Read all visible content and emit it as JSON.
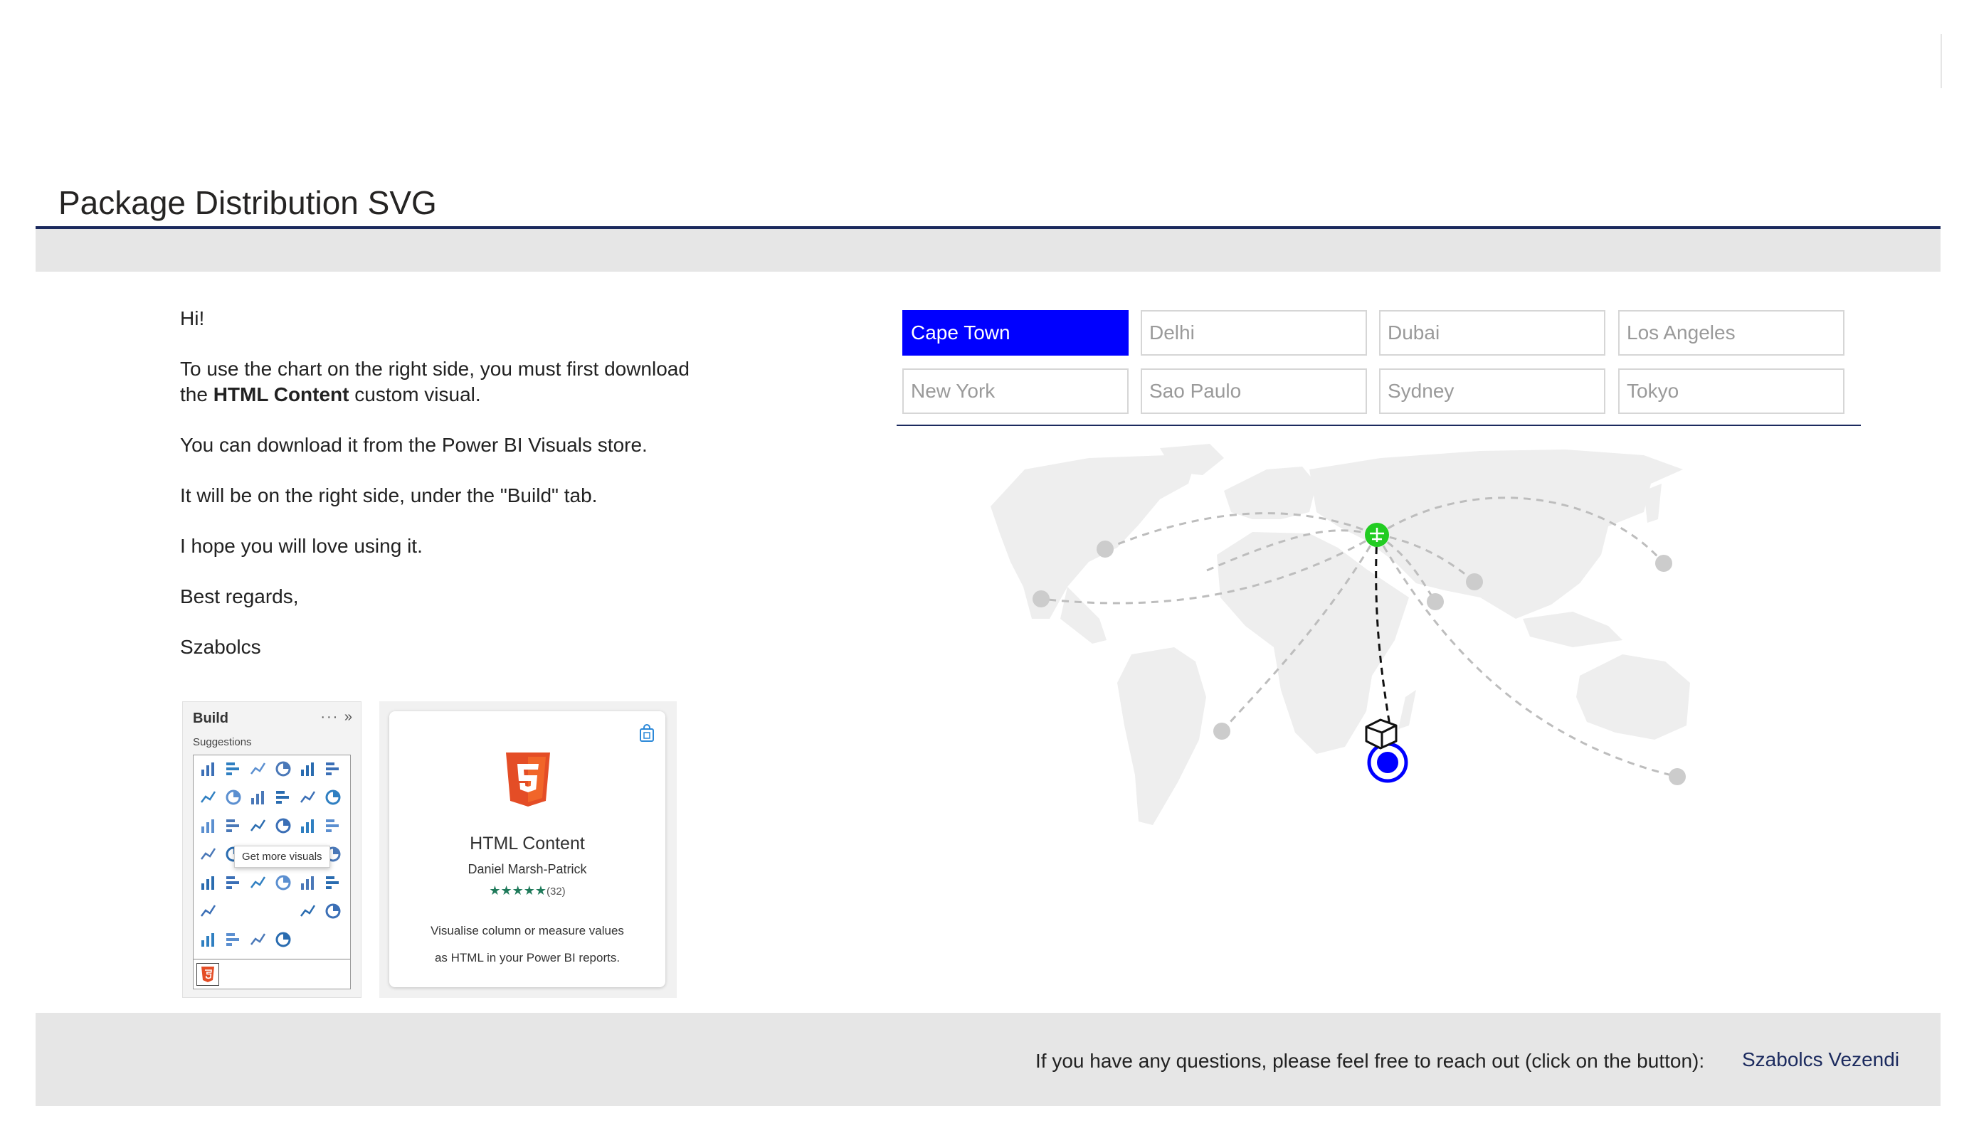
{
  "page": {
    "title": "Package Distribution SVG"
  },
  "intro": {
    "greeting": "Hi!",
    "line1_pre": "To use the chart on the right side, you must first download the ",
    "line1_bold": "HTML Content",
    "line1_post": " custom visual.",
    "line2": "You can download it from the Power BI Visuals store.",
    "line3": "It will be on the right side, under the \"Build\" tab.",
    "line4": "I hope you will love using it.",
    "line5": "Best regards,",
    "signature": "Szabolcs"
  },
  "build_pane": {
    "title": "Build",
    "actions": "··· »",
    "subtitle": "Suggestions",
    "tooltip": "Get more visuals"
  },
  "visual_card": {
    "name": "HTML Content",
    "author": "Daniel Marsh-Patrick",
    "stars": "★★★★★",
    "rating_count": "(32)",
    "description_line1": "Visualise column or measure values",
    "description_line2": "as HTML in your Power BI reports."
  },
  "slicer": {
    "cities": [
      "Cape Town",
      "Delhi",
      "Dubai",
      "Los Angeles",
      "New York",
      "Sao Paulo",
      "Sydney",
      "Tokyo"
    ],
    "selected": "Cape Town",
    "active_color": "#0000ff"
  },
  "map": {
    "hub_color": "#22cc22",
    "destination_color": "#0000ff",
    "node_color": "#cccccc",
    "land_color": "#eeeeee",
    "icons": [
      "hub-icon",
      "package-icon",
      "destination-icon"
    ]
  },
  "footer": {
    "contact_text": "If you have any questions, please feel free to reach out (click on the button):",
    "contact_link": "Szabolcs Vezendi"
  }
}
